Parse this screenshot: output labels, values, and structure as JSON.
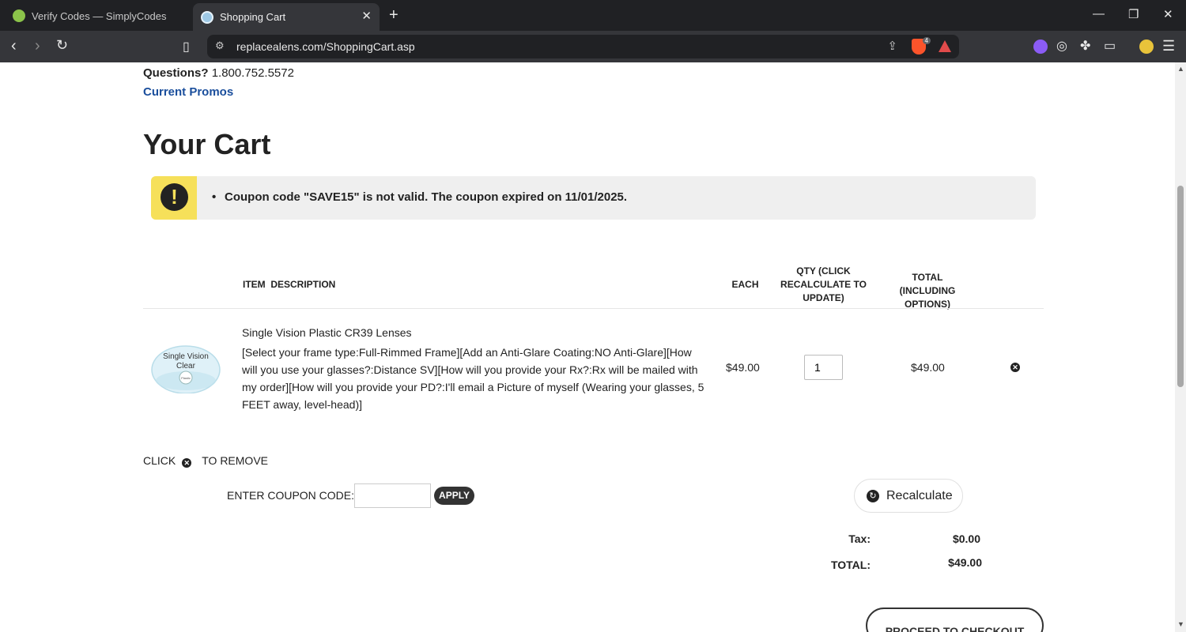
{
  "browser": {
    "tabs": [
      {
        "title": "Verify Codes — SimplyCodes",
        "active": false
      },
      {
        "title": "Shopping Cart",
        "active": true
      }
    ],
    "url": "replacealens.com/ShoppingCart.asp",
    "brave_badge": "4"
  },
  "header": {
    "questions_label": "Questions?",
    "phone": "1.800.752.5572",
    "promos_link": "Current Promos"
  },
  "page_title": "Your Cart",
  "alert": {
    "message": "Coupon code \"SAVE15\" is not valid. The coupon expired on 11/01/2025.",
    "color": "#f6e05a"
  },
  "table": {
    "headers": {
      "description": "ITEM  DESCRIPTION",
      "each": "EACH",
      "qty": "QTY (CLICK RECALCULATE TO UPDATE)",
      "total": "TOTAL (INCLUDING OPTIONS)"
    },
    "rows": [
      {
        "image_text_1": "Single Vision",
        "image_text_2": "Clear",
        "image_text_3": "Plastic",
        "name": "Single Vision Plastic CR39 Lenses",
        "options": "[Select your frame type:Full-Rimmed Frame][Add an Anti-Glare Coating:NO Anti-Glare][How will you use your glasses?:Distance SV][How will you provide your Rx?:Rx will be mailed with my order][How will you provide your PD?:I'll email a Picture of myself (Wearing your glasses, 5 FEET away, level-head)]",
        "each": "$49.00",
        "qty": "1",
        "total": "$49.00"
      }
    ]
  },
  "remove_note": {
    "before": "CLICK",
    "after": "TO REMOVE"
  },
  "coupon": {
    "label": "ENTER COUPON CODE:",
    "value": "",
    "apply_label": "APPLY"
  },
  "recalculate_label": "Recalculate",
  "summary": {
    "tax_label": "Tax:",
    "tax_value": "$0.00",
    "total_label": "TOTAL:",
    "total_value": "$49.00"
  },
  "checkout_label": "PROCEED TO CHECKOUT",
  "colors": {
    "link": "#1a4e9c",
    "button_dark": "#333333"
  }
}
